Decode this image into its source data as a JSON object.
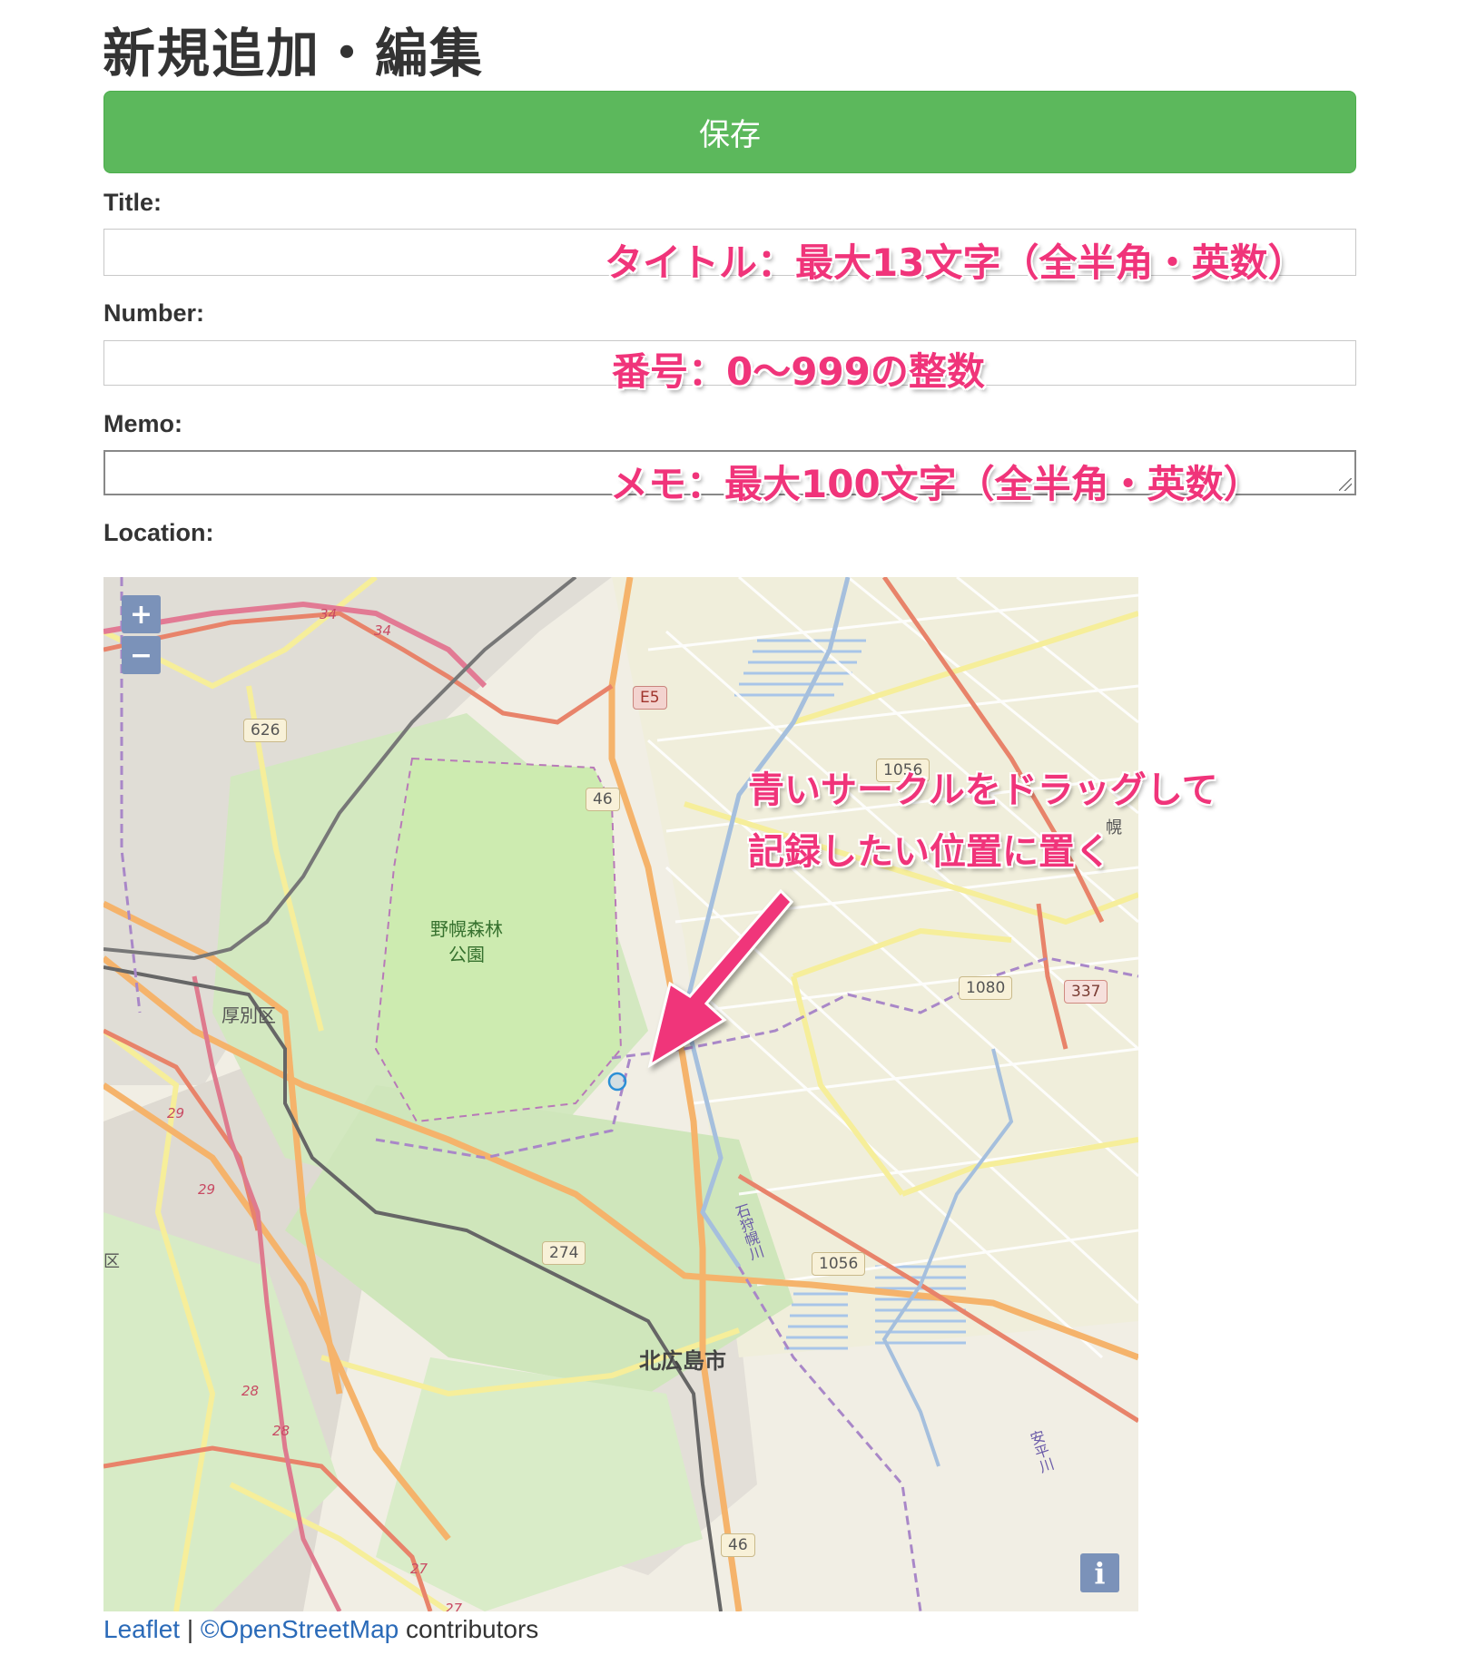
{
  "page": {
    "title": "新規追加・編集"
  },
  "save_button": {
    "label": "保存"
  },
  "fields": {
    "title": {
      "label": "Title:",
      "value": ""
    },
    "number": {
      "label": "Number:",
      "value": ""
    },
    "memo": {
      "label": "Memo:",
      "value": ""
    },
    "location": {
      "label": "Location:"
    }
  },
  "annotations": {
    "title_hint": "タイトル：最大13文字（全半角・英数）",
    "number_hint": "番号：0〜999の整数",
    "memo_hint": "メモ：最大100文字（全半角・英数）",
    "map_hint_line1": "青いサークルをドラッグして",
    "map_hint_line2": "記録したい位置に置く",
    "arrow_color": "#f0347a"
  },
  "map": {
    "zoom_in": "+",
    "zoom_out": "−",
    "info": "i",
    "labels": {
      "park": "野幌森林",
      "park2": "公園",
      "ward": "厚別区",
      "city": "北広島市",
      "ward_edge": "区",
      "river": "石狩幌川",
      "river2": "安平川",
      "top_right": "幌"
    },
    "route_shields": [
      "E5",
      "626",
      "46",
      "1056",
      "1080",
      "337",
      "274",
      "1056",
      "46"
    ],
    "red_route_numbers": [
      "34",
      "34",
      "29",
      "29",
      "28",
      "28",
      "27",
      "27"
    ],
    "marker_color": "#2b8fd6",
    "park_color": "#cdebb0"
  },
  "attribution": {
    "leaflet": "Leaflet",
    "separator": " | ",
    "osm": "©OpenStreetMap",
    "contributors": " contributors"
  }
}
